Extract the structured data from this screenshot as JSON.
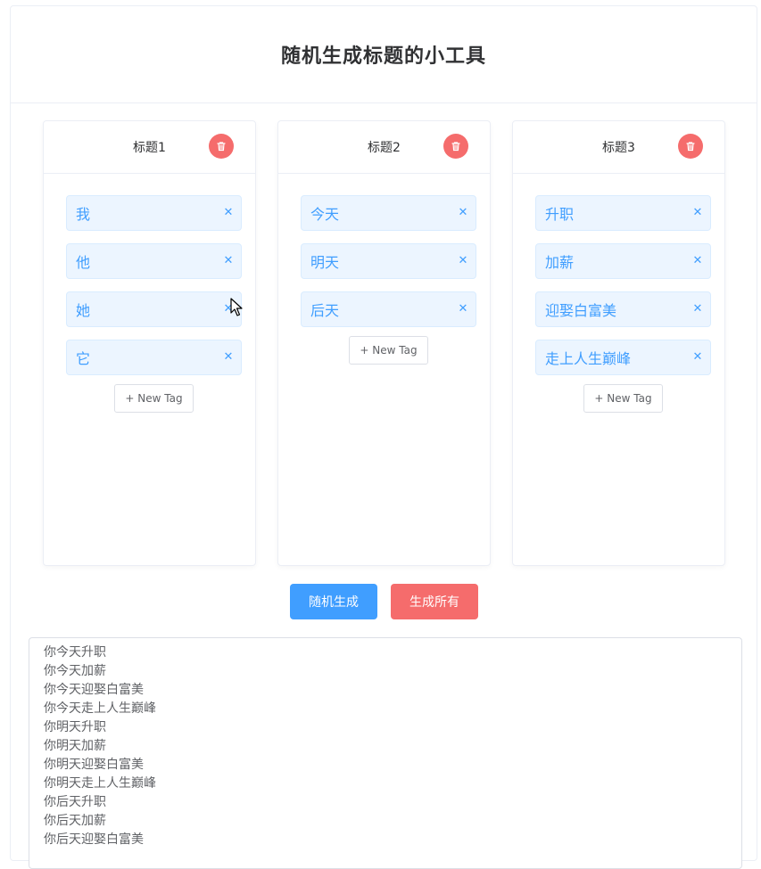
{
  "app": {
    "title": "随机生成标题的小工具"
  },
  "columns": [
    {
      "title": "标题1",
      "tags": [
        "我",
        "他",
        "她",
        "它"
      ],
      "new_tag_label": "+ New Tag"
    },
    {
      "title": "标题2",
      "tags": [
        "今天",
        "明天",
        "后天"
      ],
      "new_tag_label": "+ New Tag"
    },
    {
      "title": "标题3",
      "tags": [
        "升职",
        "加薪",
        "迎娶白富美",
        "走上人生巅峰"
      ],
      "new_tag_label": "+ New Tag"
    }
  ],
  "actions": {
    "random_label": "随机生成",
    "all_label": "生成所有"
  },
  "output": {
    "lines": [
      "你今天升职",
      "你今天加薪",
      "你今天迎娶白富美",
      "你今天走上人生巅峰",
      "你明天升职",
      "你明天加薪",
      "你明天迎娶白富美",
      "你明天走上人生巅峰",
      "你后天升职",
      "你后天加薪",
      "你后天迎娶白富美"
    ]
  },
  "icons": {
    "delete": "trash-icon",
    "close": "close-icon",
    "cursor": "mouse-pointer-icon"
  },
  "colors": {
    "primary": "#409eff",
    "danger": "#f56c6c",
    "tag_bg": "#ecf5ff",
    "tag_border": "#d9ecff"
  }
}
